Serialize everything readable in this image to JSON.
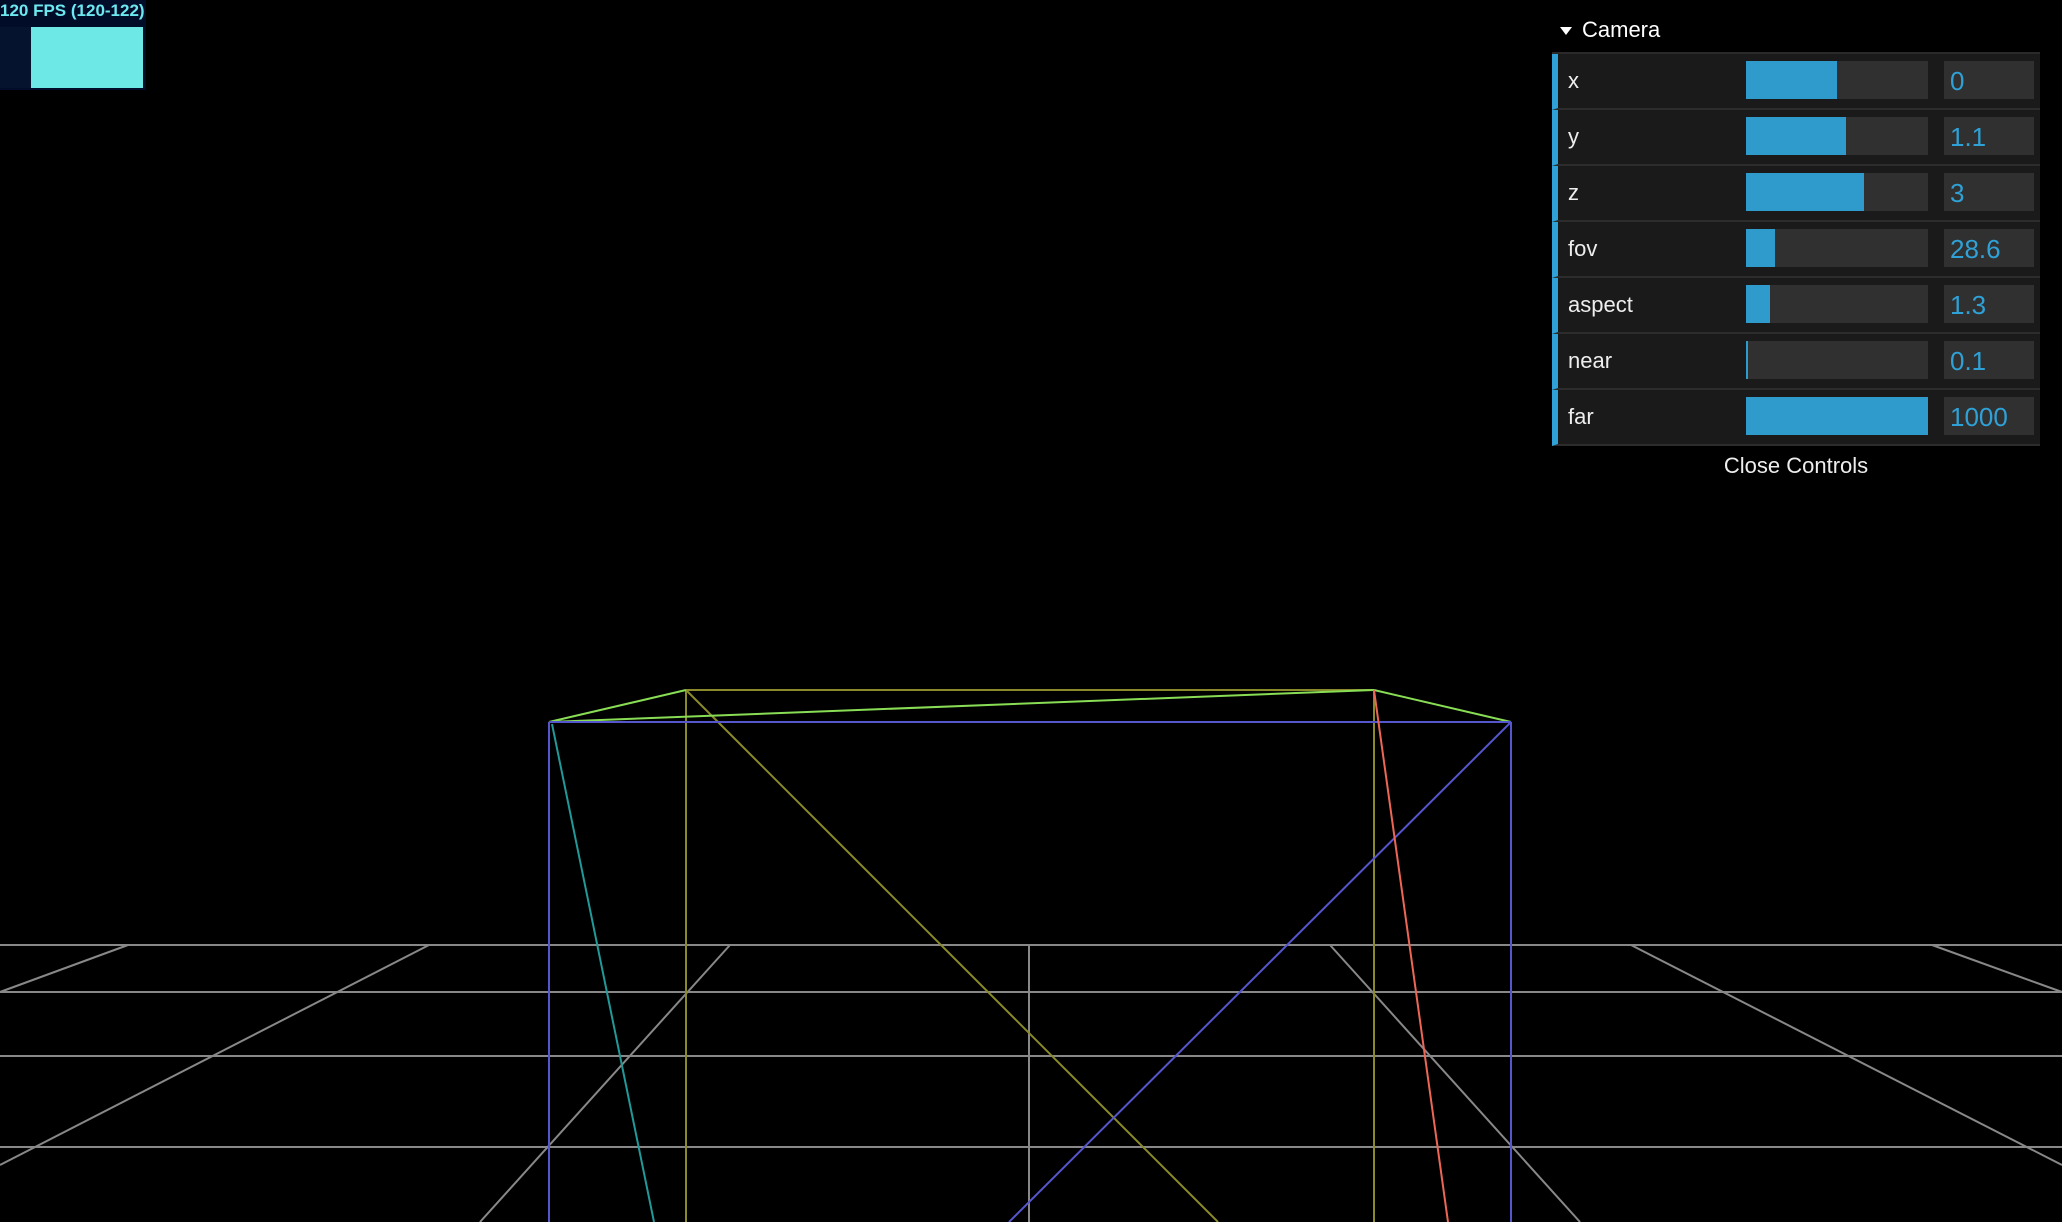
{
  "stats": {
    "fps_text": "120 FPS (120-122)"
  },
  "gui": {
    "folder_title": "Camera",
    "controls": [
      {
        "label": "x",
        "value": "0",
        "fraction": 0.5
      },
      {
        "label": "y",
        "value": "1.1",
        "fraction": 0.55
      },
      {
        "label": "z",
        "value": "3",
        "fraction": 0.65
      },
      {
        "label": "fov",
        "value": "28.6",
        "fraction": 0.16
      },
      {
        "label": "aspect",
        "value": "1.3",
        "fraction": 0.13
      },
      {
        "label": "near",
        "value": "0.1",
        "fraction": 0.01
      },
      {
        "label": "far",
        "value": "1000",
        "fraction": 1.0
      }
    ],
    "close_label": "Close Controls"
  },
  "colors": {
    "accent": "#2fa1d6",
    "fps": "#6de8f0",
    "grid": "#888888",
    "frustum_blue": "#5555cc",
    "frustum_olive": "#8a8a2a",
    "frustum_green": "#88dd55",
    "frustum_cyan": "#229999",
    "frustum_red": "#ee6655"
  }
}
